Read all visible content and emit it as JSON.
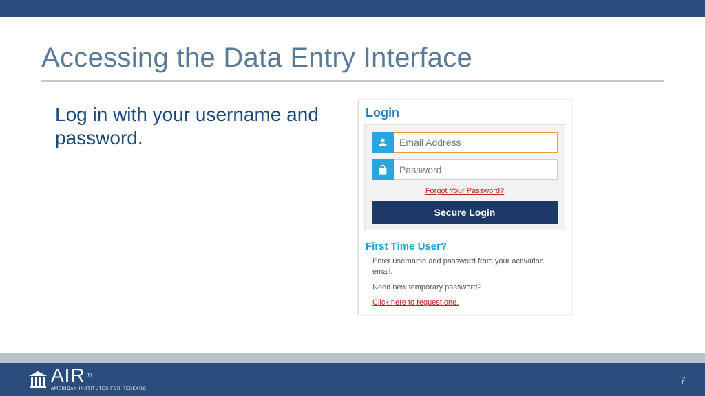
{
  "slide": {
    "title": "Accessing the Data Entry Interface",
    "body": "Log in with your username and password.",
    "page_number": "7"
  },
  "login": {
    "heading": "Login",
    "email_placeholder": "Email Address",
    "password_placeholder": "Password",
    "forgot_label": "Forgot Your Password?",
    "secure_login_label": "Secure Login",
    "ftu_heading": "First Time User?",
    "ftu_text1": "Enter username and password from your activation email.",
    "ftu_text2": "Need new temporary password?",
    "ftu_link": "Click here to request one."
  },
  "brand": {
    "name": "AIR",
    "tagline": "AMERICAN INSTITUTES FOR RESEARCH",
    "reg": "®"
  }
}
